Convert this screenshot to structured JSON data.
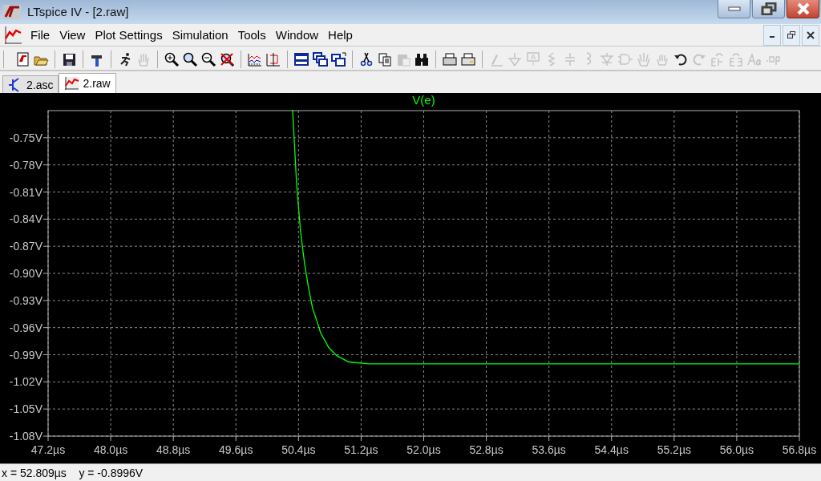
{
  "window": {
    "title": "LTspice IV - [2.raw]"
  },
  "menu": [
    "File",
    "View",
    "Plot Settings",
    "Simulation",
    "Tools",
    "Window",
    "Help"
  ],
  "toolbar": [
    [
      {
        "disabled": false
      },
      {
        "disabled": false
      }
    ],
    [
      {
        "disabled": false
      }
    ],
    [
      {
        "disabled": false
      }
    ],
    [
      {
        "disabled": false
      },
      {
        "disabled": true
      }
    ],
    [
      {
        "disabled": false
      },
      {
        "disabled": false
      },
      {
        "disabled": false
      },
      {
        "disabled": false
      }
    ],
    [
      {
        "disabled": false
      },
      {
        "disabled": false
      }
    ],
    [
      {
        "disabled": false
      },
      {
        "disabled": false
      },
      {
        "disabled": false
      }
    ],
    [
      {
        "disabled": false
      },
      {
        "disabled": false
      },
      {
        "disabled": true
      },
      {
        "disabled": false
      }
    ],
    [
      {
        "disabled": false
      },
      {
        "disabled": false
      }
    ],
    [
      {
        "disabled": true
      },
      {
        "disabled": true
      },
      {
        "disabled": true
      },
      {
        "disabled": true
      },
      {
        "disabled": true
      },
      {
        "disabled": true
      },
      {
        "disabled": true
      },
      {
        "disabled": true
      },
      {
        "disabled": true
      },
      {
        "disabled": true
      },
      {
        "disabled": false
      },
      {
        "disabled": true
      },
      {
        "disabled": true
      },
      {
        "disabled": true
      },
      {
        "disabled": true
      },
      {
        "disabled": true
      }
    ]
  ],
  "tabs": [
    {
      "label": "2.asc",
      "kind": "schematic",
      "selected": false
    },
    {
      "label": "2.raw",
      "kind": "waveform",
      "selected": true
    }
  ],
  "plot": {
    "chart_data": {
      "type": "line",
      "grid": true,
      "xlim": [
        47.2,
        56.8
      ],
      "ylim": [
        -1.08,
        -0.72
      ],
      "xticks": [
        {
          "value": 47.2,
          "label": "47.2µs"
        },
        {
          "value": 48.0,
          "label": "48.0µs"
        },
        {
          "value": 48.8,
          "label": "48.8µs"
        },
        {
          "value": 49.6,
          "label": "49.6µs"
        },
        {
          "value": 50.4,
          "label": "50.4µs"
        },
        {
          "value": 51.2,
          "label": "51.2µs"
        },
        {
          "value": 52.0,
          "label": "52.0µs"
        },
        {
          "value": 52.8,
          "label": "52.8µs"
        },
        {
          "value": 53.6,
          "label": "53.6µs"
        },
        {
          "value": 54.4,
          "label": "54.4µs"
        },
        {
          "value": 55.2,
          "label": "55.2µs"
        },
        {
          "value": 56.0,
          "label": "56.0µs"
        },
        {
          "value": 56.8,
          "label": "56.8µs"
        }
      ],
      "yticks": [
        {
          "value": -0.75,
          "label": "-0.75V"
        },
        {
          "value": -0.78,
          "label": "-0.78V"
        },
        {
          "value": -0.81,
          "label": "-0.81V"
        },
        {
          "value": -0.84,
          "label": "-0.84V"
        },
        {
          "value": -0.87,
          "label": "-0.87V"
        },
        {
          "value": -0.9,
          "label": "-0.90V"
        },
        {
          "value": -0.93,
          "label": "-0.93V"
        },
        {
          "value": -0.96,
          "label": "-0.96V"
        },
        {
          "value": -0.99,
          "label": "-0.99V"
        },
        {
          "value": -1.02,
          "label": "-1.02V"
        },
        {
          "value": -1.05,
          "label": "-1.05V"
        },
        {
          "value": -1.08,
          "label": "-1.08V"
        }
      ],
      "x": [
        50.325,
        50.376,
        50.427,
        50.479,
        50.53,
        50.581,
        50.632,
        50.683,
        50.786,
        50.888,
        51.042,
        51.298,
        56.8
      ],
      "series": [
        {
          "name": "V(e)",
          "color": "#00ff00",
          "values": [
            -0.72,
            -0.802,
            -0.855,
            -0.89,
            -0.917,
            -0.939,
            -0.952,
            -0.966,
            -0.982,
            -0.991,
            -0.998,
            -1.0,
            -1.0
          ]
        }
      ]
    }
  },
  "status_bar": "x = 52.809µs    y = -0.8996V"
}
